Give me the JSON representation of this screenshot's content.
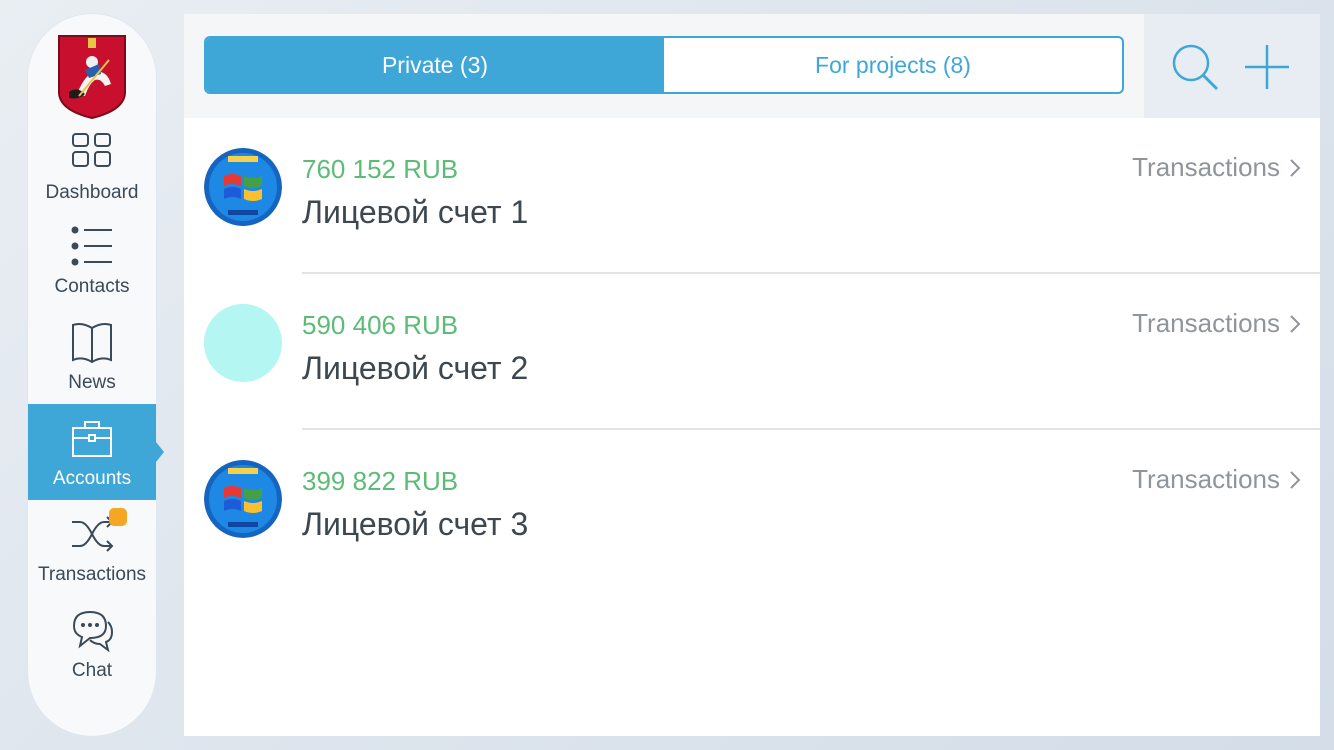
{
  "sidebar": {
    "logo_icon": "moscow-coat-of-arms",
    "items": [
      {
        "label": "Dashboard",
        "icon": "grid-icon"
      },
      {
        "label": "Contacts",
        "icon": "list-icon"
      },
      {
        "label": "News",
        "icon": "book-icon"
      },
      {
        "label": "Accounts",
        "icon": "briefcase-icon",
        "active": true
      },
      {
        "label": "Transactions",
        "icon": "shuffle-icon",
        "badge": true
      },
      {
        "label": "Chat",
        "icon": "chat-bubbles-icon"
      }
    ]
  },
  "tabs": {
    "private_label": "Private (3)",
    "projects_label": "For projects (8)",
    "active": "private"
  },
  "actions": {
    "search_icon": "search-icon",
    "add_icon": "plus-icon"
  },
  "accounts": [
    {
      "amount": "760 152 RUB",
      "name": "Лицевой счет 1",
      "link": "Transactions",
      "avatar": "windows-logo"
    },
    {
      "amount": "590 406 RUB",
      "name": "Лицевой счет 2",
      "link": "Transactions",
      "avatar": "plain-circle"
    },
    {
      "amount": "399 822 RUB",
      "name": "Лицевой счет 3",
      "link": "Transactions",
      "avatar": "windows-logo"
    }
  ],
  "colors": {
    "accent": "#3ea7d7",
    "amount": "#5dbb78",
    "badge": "#f5a623",
    "placeholder_avatar": "#b3f6f2"
  }
}
